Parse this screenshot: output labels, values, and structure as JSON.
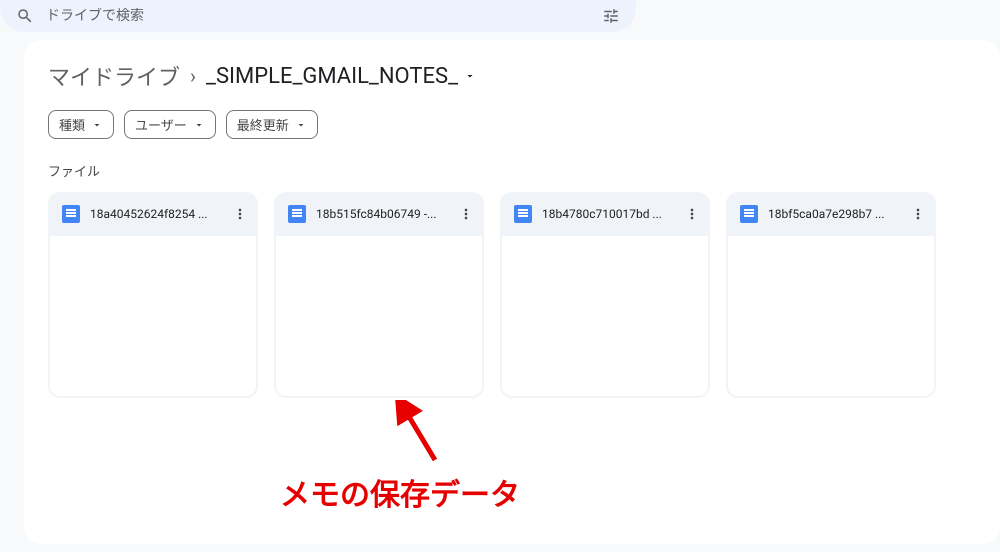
{
  "search": {
    "placeholder": "ドライブで検索"
  },
  "breadcrumb": {
    "root": "マイドライブ",
    "current": "_SIMPLE_GMAIL_NOTES_"
  },
  "filters": {
    "type": "種類",
    "user": "ユーザー",
    "modified": "最終更新"
  },
  "section": {
    "files_label": "ファイル"
  },
  "files": [
    {
      "name": "18a40452624f8254 ..."
    },
    {
      "name": "18b515fc84b06749 -..."
    },
    {
      "name": "18b4780c710017bd ..."
    },
    {
      "name": "18bf5ca0a7e298b7 ..."
    }
  ],
  "annotation": {
    "text": "メモの保存データ"
  }
}
